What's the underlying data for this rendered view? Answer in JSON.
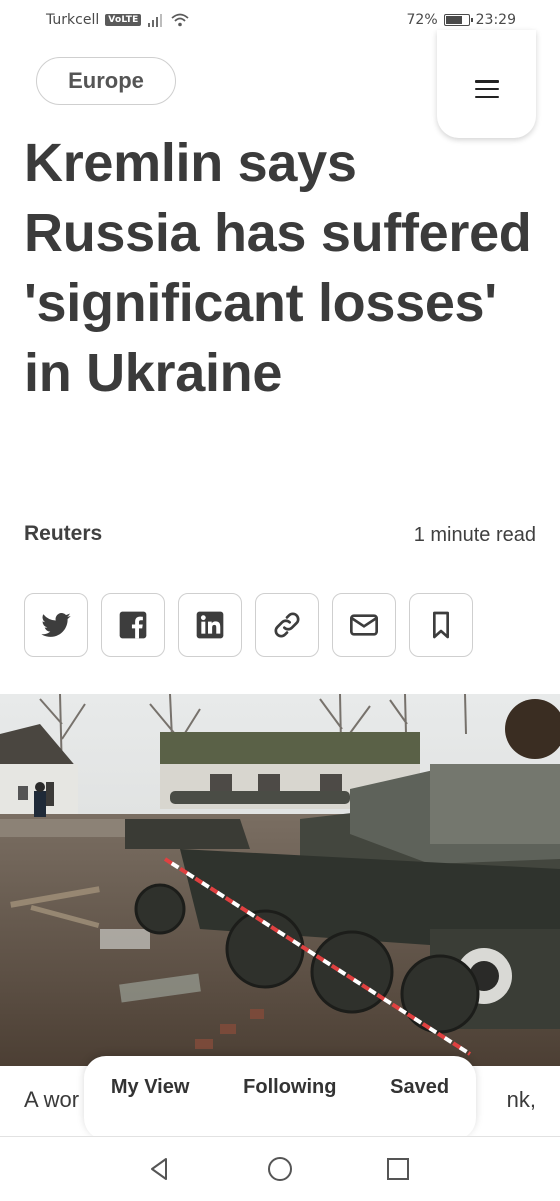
{
  "status_bar": {
    "carrier": "Turkcell",
    "volte": "VoLTE",
    "battery": "72%",
    "time": "23:29"
  },
  "header": {
    "section": "Europe",
    "menu_icon": "hamburger-menu-icon"
  },
  "article": {
    "headline": "Kremlin says Russia has suffered 'significant losses' in Ukraine",
    "source": "Reuters",
    "read_time": "1 minute read",
    "snippet_left": "A wor",
    "snippet_right": "nk,"
  },
  "share": {
    "icons": [
      "twitter-icon",
      "facebook-icon",
      "linkedin-icon",
      "link-icon",
      "email-icon",
      "bookmark-icon"
    ]
  },
  "bottom_tabs": {
    "tabs": [
      {
        "label": "My View"
      },
      {
        "label": "Following"
      },
      {
        "label": "Saved"
      }
    ]
  },
  "nav": {
    "back": "back-icon",
    "home": "home-icon",
    "recents": "recents-icon"
  },
  "colors": {
    "text": "#3b3b3b",
    "border": "#cfcfcf",
    "background": "#ffffff"
  }
}
